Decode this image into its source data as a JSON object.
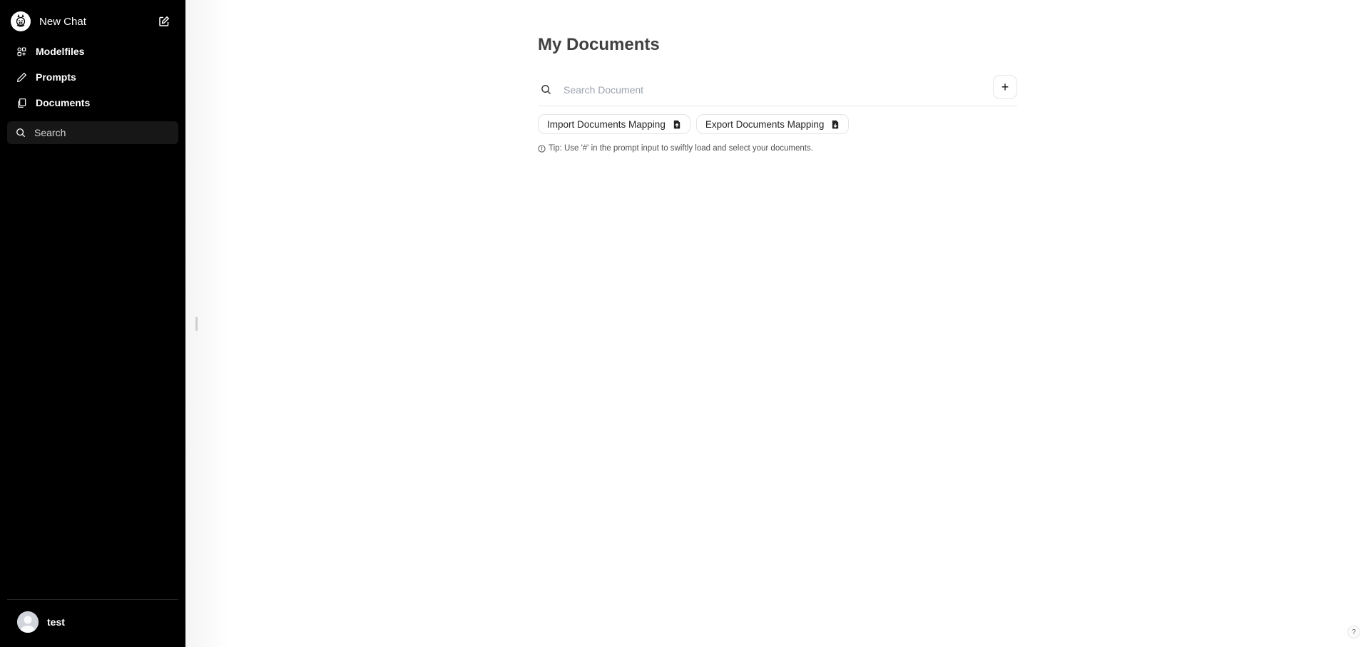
{
  "sidebar": {
    "new_chat_label": "New Chat",
    "items": [
      {
        "label": "Modelfiles",
        "icon": "modelfiles-icon"
      },
      {
        "label": "Prompts",
        "icon": "pencil-icon"
      },
      {
        "label": "Documents",
        "icon": "documents-icon"
      }
    ],
    "search_placeholder": "Search",
    "user_name": "test"
  },
  "main": {
    "title": "My Documents",
    "search_placeholder": "Search Document",
    "add_label": "+",
    "import_label": "Import Documents Mapping",
    "export_label": "Export Documents Mapping",
    "tip": "Tip: Use '#' in the prompt input to swiftly load and select your documents."
  },
  "help_label": "?",
  "colors": {
    "sidebar_bg": "#000000",
    "sidebar_search_bg": "#171717",
    "title_text": "#404040"
  }
}
